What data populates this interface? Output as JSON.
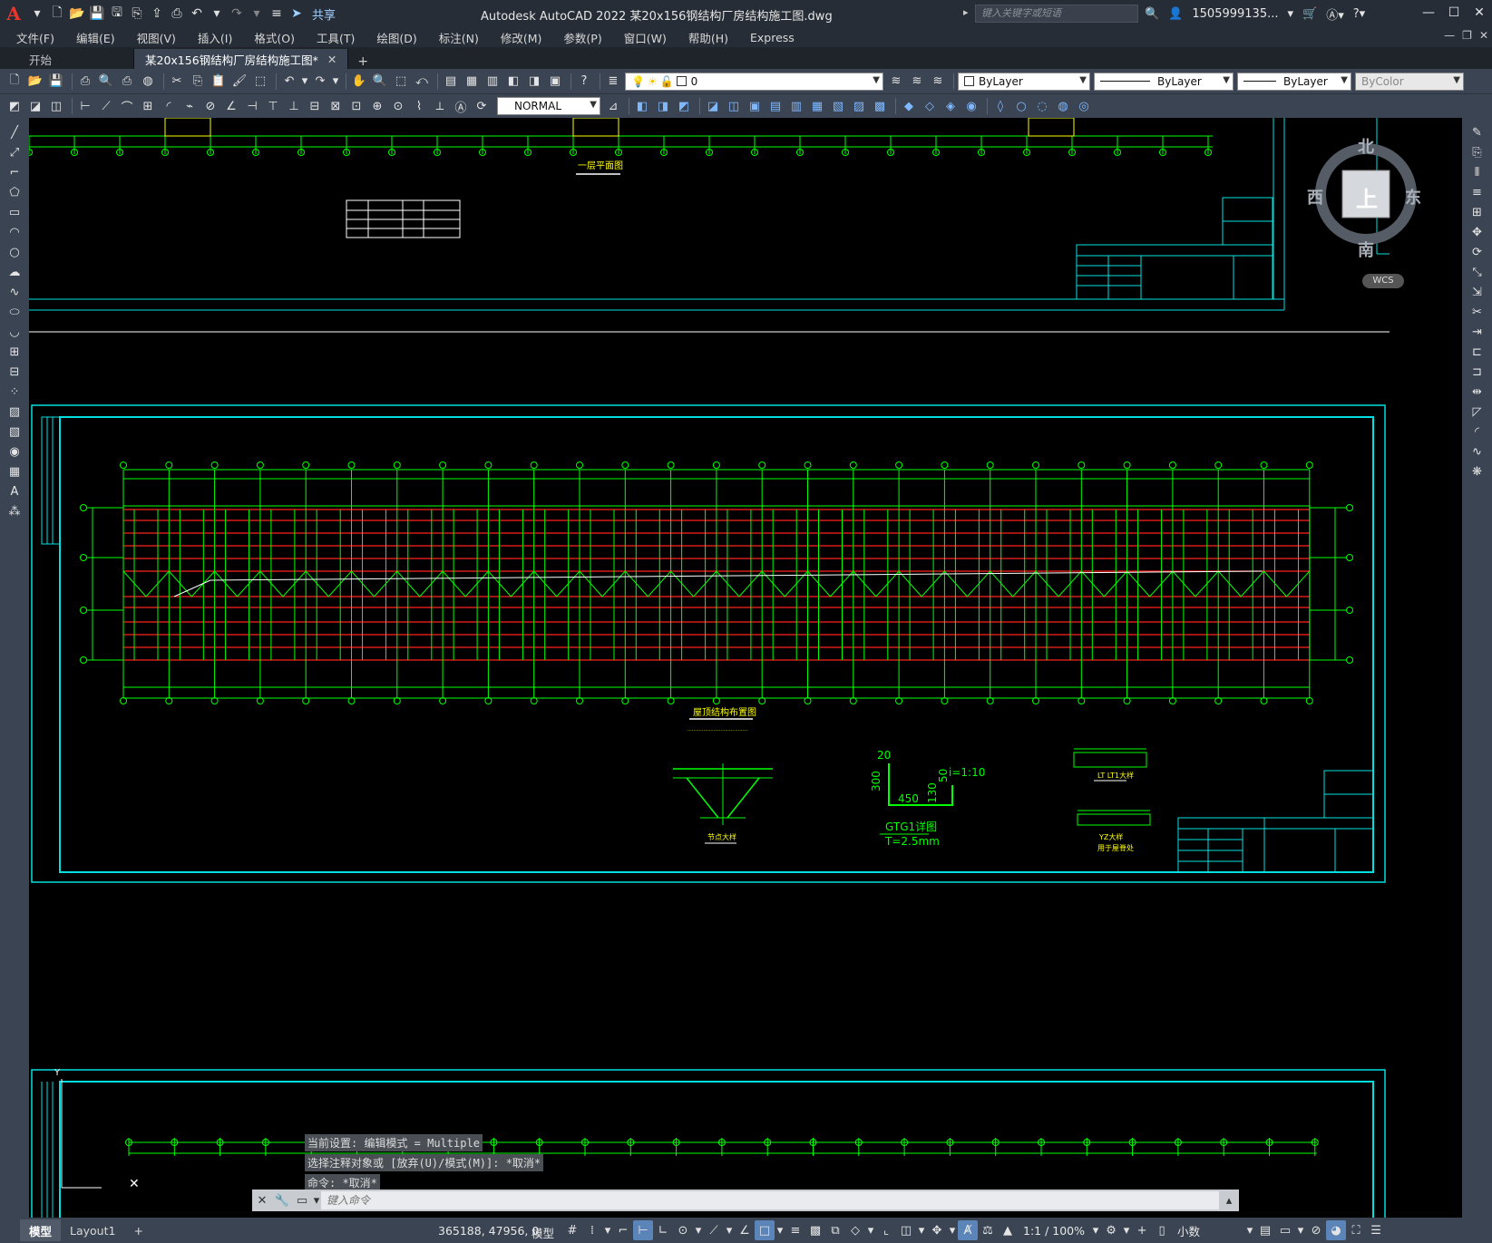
{
  "titlebar": {
    "app_title": "Autodesk AutoCAD 2022    某20x156钢结构厂房结构施工图.dwg",
    "share_label": "共享",
    "search_placeholder": "键入关键字或短语",
    "user_name": "1505999135...",
    "logo_text": "A"
  },
  "menu": {
    "items": [
      "文件(F)",
      "编辑(E)",
      "视图(V)",
      "插入(I)",
      "格式(O)",
      "工具(T)",
      "绘图(D)",
      "标注(N)",
      "修改(M)",
      "参数(P)",
      "窗口(W)",
      "帮助(H)",
      "Express"
    ]
  },
  "tabs": {
    "start": "开始",
    "document": "某20x156钢结构厂房结构施工图*"
  },
  "toolbar": {
    "layer_value": "0",
    "color_value": "ByLayer",
    "linetype_value": "ByLayer",
    "lineweight_value": "ByLayer",
    "plotstyle_value": "ByColor",
    "dimstyle_value": "NORMAL"
  },
  "viewcube": {
    "north": "北",
    "south": "南",
    "east": "东",
    "west": "西",
    "face": "上",
    "wcs": "WCS"
  },
  "drawing": {
    "plan_title": "一层平面图",
    "roof_title": "屋顶结构布置图",
    "gtg_label": "GTG1详图",
    "thickness": "T=2.5mm",
    "dim_20": "20",
    "dim_300": "300",
    "dim_450": "450",
    "dim_130": "130",
    "dim_50": "50",
    "slope": "i=1:10",
    "detail_lt": "LT LT1大样",
    "detail_yz": "YZ大样",
    "detail_note": "用于屋脊处",
    "detail_node": "节点大样"
  },
  "command": {
    "line1": "当前设置: 编辑模式 = Multiple",
    "line2": "选择注释对象或 [放弃(U)/模式(M)]: *取消*",
    "line3": "命令: *取消*",
    "placeholder": "键入命令"
  },
  "statusbar": {
    "model_tab": "模型",
    "layout_tab": "Layout1",
    "coords": "365188, 47956, 0",
    "model_btn": "模型",
    "scale": "1:1 / 100%",
    "units": "小数"
  },
  "colors": {
    "line_green": "#00ff00",
    "line_red": "#ff2020",
    "frame_cyan": "#00e0e0",
    "chrome": "#3b4452"
  }
}
